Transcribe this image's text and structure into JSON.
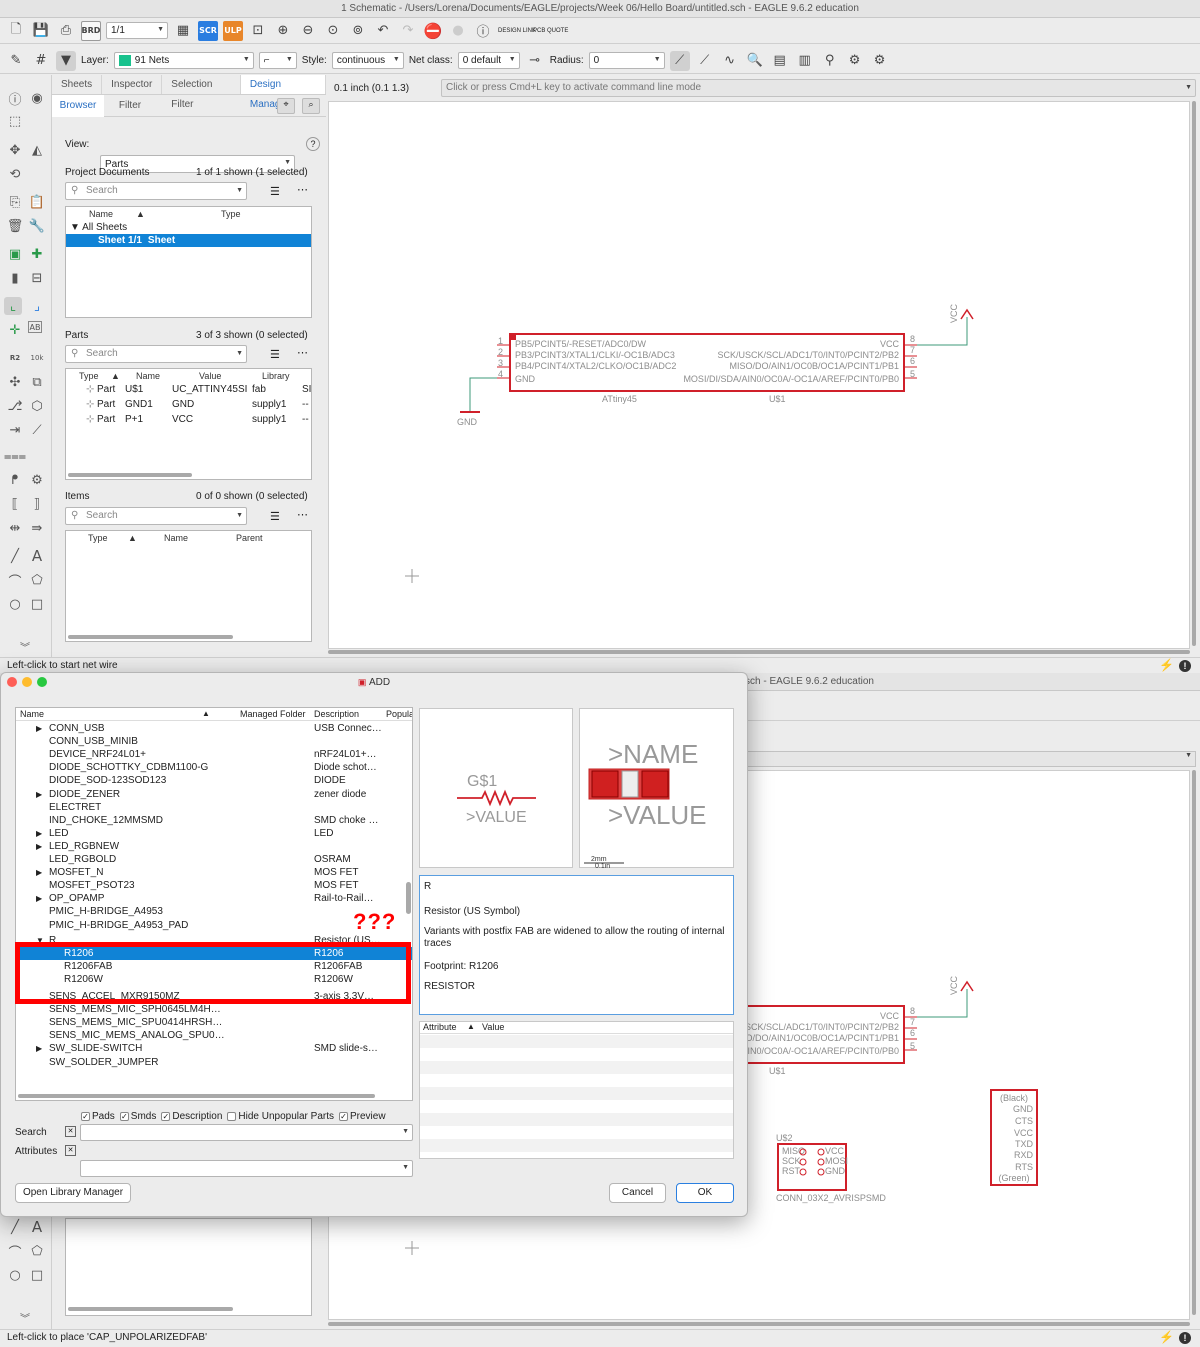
{
  "window": {
    "title": "1 Schematic - /Users/Lorena/Documents/EAGLE/projects/Week 06/Hello Board/untitled.sch - EAGLE 9.6.2 education",
    "title2": "sch - EAGLE 9.6.2 education"
  },
  "toolbar1": {
    "sheet_value": "1/1",
    "design_link": "DESIGN LINK",
    "pcb_quote": "PCB QUOTE"
  },
  "toolbar2": {
    "layer_label": "Layer:",
    "layer_value": "91 Nets",
    "layer_color": "#18c28d",
    "style_label": "Style:",
    "style_value": "continuous",
    "netclass_label": "Net class:",
    "netclass_value": "0 default",
    "radius_label": "Radius:",
    "radius_value": "0"
  },
  "tabs": [
    "Sheets",
    "Inspector",
    "Selection Filter",
    "Design Manager"
  ],
  "subtabs": [
    "Browser",
    "Filter"
  ],
  "coord": "0.1 inch (0.1 1.3)",
  "command_placeholder": "Click or press Cmd+L key to activate command line mode",
  "view": {
    "label": "View:",
    "value": "Parts"
  },
  "project_docs": {
    "title": "Project Documents",
    "count": "1 of 1 shown (1 selected)",
    "search": "Search",
    "cols": [
      "Name",
      "Type"
    ],
    "rows": [
      {
        "name": "All Sheets",
        "type": ""
      },
      {
        "name": "Sheet 1/1",
        "type": "Sheet"
      }
    ]
  },
  "parts": {
    "title": "Parts",
    "count": "3 of 3 shown (0 selected)",
    "search": "Search",
    "cols": [
      "Type",
      "Name",
      "Value",
      "Library"
    ],
    "rows": [
      {
        "type": "Part",
        "name": "U$1",
        "value": "UC_ATTINY45SI",
        "library": "fab",
        "extra": "SI"
      },
      {
        "type": "Part",
        "name": "GND1",
        "value": "GND",
        "library": "supply1",
        "extra": "--"
      },
      {
        "type": "Part",
        "name": "P+1",
        "value": "VCC",
        "library": "supply1",
        "extra": "--"
      }
    ]
  },
  "items": {
    "title": "Items",
    "count": "0 of 0 shown (0 selected)",
    "search": "Search",
    "cols": [
      "Type",
      "Name",
      "Parent"
    ]
  },
  "schematic": {
    "chip_name": "ATtiny45",
    "chip_ref": "U$1",
    "left_pins": [
      "PB5/PCINT5/-RESET/ADC0/DW",
      "PB3/PCINT3/XTAL1/CLKI/-OC1B/ADC3",
      "PB4/PCINT4/XTAL2/CLKO/OC1B/ADC2",
      "GND"
    ],
    "left_nums": [
      "1",
      "2",
      "3",
      "4"
    ],
    "right_pins": [
      "VCC",
      "SCK/USCK/SCL/ADC1/T0/INT0/PCINT2/PB2",
      "MISO/DO/AIN1/OC0B/OC1A/PCINT1/PB1",
      "MOSI/DI/SDA/AIN0/OC0A/-OC1A/AREF/PCINT0/PB0"
    ],
    "right_nums": [
      "8",
      "7",
      "6",
      "5"
    ],
    "gnd": "GND",
    "vcc": "VCC",
    "conn_ref": "U$2",
    "conn_name": "CONN_03X2_AVRISPSMD",
    "conn_pins_l": [
      "MISO",
      "SCK",
      "RST"
    ],
    "conn_pins_r": [
      "VCC",
      "MOSI",
      "GND"
    ],
    "ftdi_top": "(Black)",
    "ftdi_pins": [
      "GND",
      "CTS",
      "VCC",
      "TXD",
      "RXD",
      "RTS"
    ],
    "ftdi_bottom": "(Green)"
  },
  "status_top": "Left-click to start net wire",
  "status_bottom": "Left-click to place 'CAP_UNPOLARIZEDFAB'",
  "dialog": {
    "title": "ADD",
    "cols": [
      "Name",
      "Managed Folder",
      "Description",
      "Popular"
    ],
    "rows": [
      {
        "name": "CONN_USB",
        "desc": "USB Connec…",
        "arrow": "▶",
        "indent": 0
      },
      {
        "name": "CONN_USB_MINIB",
        "desc": "",
        "arrow": "",
        "indent": 0
      },
      {
        "name": "DEVICE_NRF24L01+",
        "desc": "nRF24L01+…",
        "arrow": "",
        "indent": 0
      },
      {
        "name": "DIODE_SCHOTTKY_CDBM1100-G",
        "desc": "Diode schot…",
        "arrow": "",
        "indent": 0
      },
      {
        "name": "DIODE_SOD-123SOD123",
        "desc": "DIODE",
        "arrow": "",
        "indent": 0
      },
      {
        "name": "DIODE_ZENER",
        "desc": "zener diode",
        "arrow": "▶",
        "indent": 0
      },
      {
        "name": "ELECTRET",
        "desc": "",
        "arrow": "",
        "indent": 0
      },
      {
        "name": "IND_CHOKE_12MMSMD",
        "desc": "SMD choke …",
        "arrow": "",
        "indent": 0
      },
      {
        "name": "LED",
        "desc": "LED",
        "arrow": "▶",
        "indent": 0
      },
      {
        "name": "LED_RGBNEW",
        "desc": "",
        "arrow": "▶",
        "indent": 0
      },
      {
        "name": "LED_RGBOLD",
        "desc": "OSRAM",
        "arrow": "",
        "indent": 0
      },
      {
        "name": "MOSFET_N",
        "desc": "MOS FET",
        "arrow": "▶",
        "indent": 0
      },
      {
        "name": "MOSFET_PSOT23",
        "desc": "MOS FET",
        "arrow": "",
        "indent": 0
      },
      {
        "name": "OP_OPAMP",
        "desc": "Rail-to-Rail…",
        "arrow": "▶",
        "indent": 0
      },
      {
        "name": "PMIC_H-BRIDGE_A4953",
        "desc": "",
        "arrow": "",
        "indent": 0
      },
      {
        "name": "PMIC_H-BRIDGE_A4953_PAD",
        "desc": "",
        "arrow": "",
        "indent": 0
      },
      {
        "name": "R",
        "desc": "Resistor (US…",
        "arrow": "▼",
        "indent": 0
      },
      {
        "name": "R1206",
        "desc": "R1206",
        "arrow": "",
        "indent": 1,
        "sel": true
      },
      {
        "name": "R1206FAB",
        "desc": "R1206FAB",
        "arrow": "",
        "indent": 1
      },
      {
        "name": "R1206W",
        "desc": "R1206W",
        "arrow": "",
        "indent": 1
      },
      {
        "name": "SENS_ACCEL_MXR9150MZ",
        "desc": "3-axis 3.3V…",
        "arrow": "",
        "indent": 0
      },
      {
        "name": "SENS_MEMS_MIC_SPH0645LM4H…",
        "desc": "",
        "arrow": "",
        "indent": 0
      },
      {
        "name": "SENS_MEMS_MIC_SPU0414HRSH…",
        "desc": "",
        "arrow": "",
        "indent": 0
      },
      {
        "name": "SENS_MIC_MEMS_ANALOG_SPU0…",
        "desc": "",
        "arrow": "",
        "indent": 0
      },
      {
        "name": "SW_SLIDE-SWITCH",
        "desc": "SMD slide-s…",
        "arrow": "▶",
        "indent": 0
      },
      {
        "name": "SW_SOLDER_JUMPER",
        "desc": "",
        "arrow": "",
        "indent": 0
      }
    ],
    "question": "???",
    "symbol_ref": "G$1",
    "symbol_value": ">VALUE",
    "pkg_name": ">NAME",
    "pkg_value": ">VALUE",
    "scale_mm": "2mm",
    "scale_in": "0.1in",
    "info_name": "R",
    "info_title": "Resistor (US Symbol)",
    "info_body": "Variants with postfix FAB are widened to allow the routing of internal traces",
    "info_footprint": "Footprint: R1206",
    "info_tag": "RESISTOR",
    "attr_cols": [
      "Attribute",
      "Value"
    ],
    "checks": [
      {
        "label": "Pads",
        "checked": true
      },
      {
        "label": "Smds",
        "checked": true
      },
      {
        "label": "Description",
        "checked": true
      },
      {
        "label": "Hide Unpopular Parts",
        "checked": false
      },
      {
        "label": "Preview",
        "checked": true
      }
    ],
    "search_label": "Search",
    "attributes_label": "Attributes",
    "open_lib": "Open Library Manager",
    "cancel": "Cancel",
    "ok": "OK"
  }
}
